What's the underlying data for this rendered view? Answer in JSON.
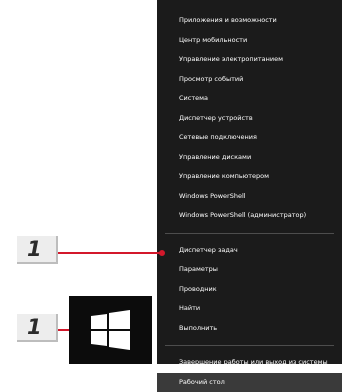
{
  "menu": {
    "items": [
      "Приложения и возможности",
      "Центр мобильности",
      "Управление электропитанием",
      "Просмотр событий",
      "Система",
      "Диспетчер устройств",
      "Сетевые подключения",
      "Управление дисками",
      "Управление компьютером",
      "Windows PowerShell",
      "Windows PowerShell (администратор)"
    ],
    "items2": [
      "Диспетчер задач",
      "Параметры",
      "Проводник",
      "Найти",
      "Выполнить"
    ],
    "items3": [
      "Завершение работы или выход из системы",
      "Рабочий стол"
    ]
  },
  "callouts": {
    "badge_top": "1",
    "badge_bottom": "1",
    "accent_color": "#d3182b"
  },
  "start_button": {
    "icon": "windows-logo-icon"
  }
}
